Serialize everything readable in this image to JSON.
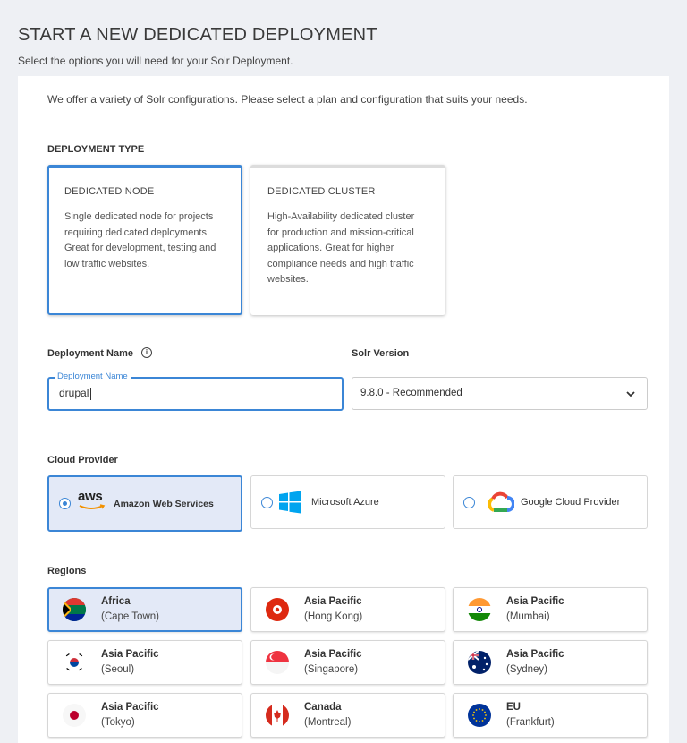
{
  "header": {
    "title": "START A NEW DEDICATED DEPLOYMENT",
    "subtitle": "Select the options you will need for your Solr Deployment."
  },
  "intro": "We offer a variety of Solr configurations. Please select a plan and configuration that suits your needs.",
  "deployment_type": {
    "label": "DEPLOYMENT TYPE",
    "options": [
      {
        "title": "DEDICATED NODE",
        "description": "Single dedicated node for projects requiring dedicated deployments. Great for development, testing and low traffic websites.",
        "selected": true
      },
      {
        "title": "DEDICATED CLUSTER",
        "description": "High-Availability dedicated cluster for production and mission-critical applications. Great for higher compliance needs and high traffic websites.",
        "selected": false
      }
    ]
  },
  "deployment_name": {
    "label": "Deployment Name",
    "info_icon": "info-icon",
    "floating_label": "Deployment Name",
    "value": "drupal"
  },
  "solr_version": {
    "label": "Solr Version",
    "selected": "9.8.0 - Recommended"
  },
  "cloud_provider": {
    "label": "Cloud Provider",
    "options": [
      {
        "logo_text": "aws",
        "label": "Amazon Web Services",
        "selected": true,
        "icon": "aws-logo-icon"
      },
      {
        "label": "Microsoft Azure",
        "selected": false,
        "icon": "windows-logo-icon"
      },
      {
        "label": "Google Cloud Provider",
        "selected": false,
        "icon": "google-cloud-logo-icon"
      }
    ]
  },
  "regions": {
    "label": "Regions",
    "items": [
      {
        "name": "Africa",
        "city": "(Cape Town)",
        "flag": "south-africa-flag-icon",
        "selected": true
      },
      {
        "name": "Asia Pacific",
        "city": "(Hong Kong)",
        "flag": "hong-kong-flag-icon",
        "selected": false
      },
      {
        "name": "Asia Pacific",
        "city": "(Mumbai)",
        "flag": "india-flag-icon",
        "selected": false
      },
      {
        "name": "Asia Pacific",
        "city": "(Seoul)",
        "flag": "south-korea-flag-icon",
        "selected": false
      },
      {
        "name": "Asia Pacific",
        "city": "(Singapore)",
        "flag": "singapore-flag-icon",
        "selected": false
      },
      {
        "name": "Asia Pacific",
        "city": "(Sydney)",
        "flag": "australia-flag-icon",
        "selected": false
      },
      {
        "name": "Asia Pacific",
        "city": "(Tokyo)",
        "flag": "japan-flag-icon",
        "selected": false
      },
      {
        "name": "Canada",
        "city": "(Montreal)",
        "flag": "canada-flag-icon",
        "selected": false
      },
      {
        "name": "EU",
        "city": "(Frankfurt)",
        "flag": "eu-flag-icon",
        "selected": false
      }
    ]
  },
  "colors": {
    "accent": "#3b86d6",
    "selected_bg": "#e3e9f7",
    "page_bg": "#eef0f4"
  }
}
